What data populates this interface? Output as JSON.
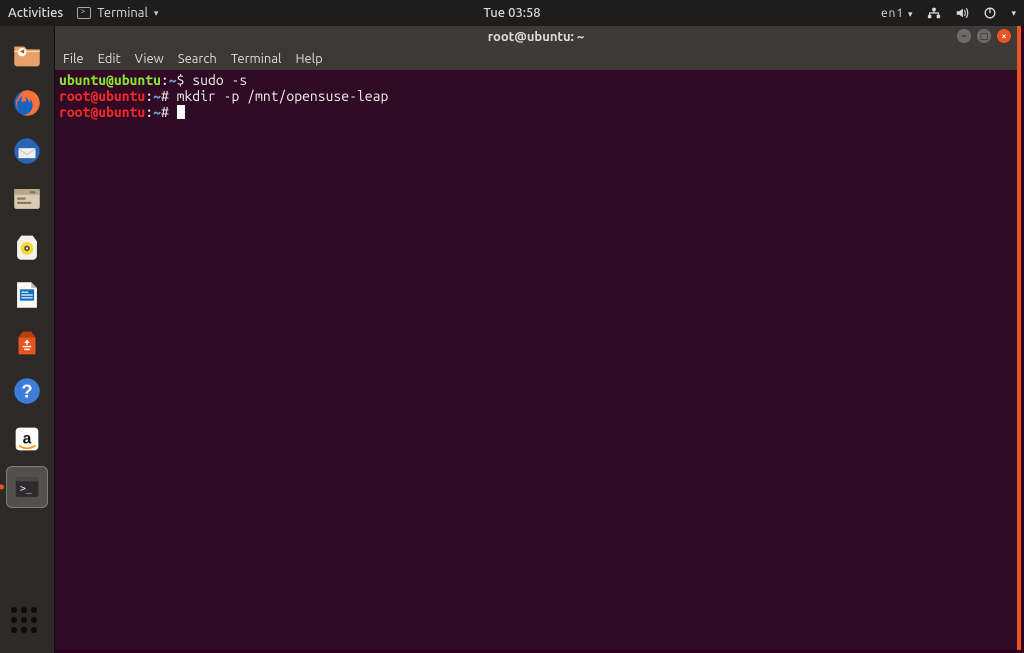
{
  "topbar": {
    "activities": "Activities",
    "app_label": "Terminal",
    "clock": "Tue 03:58",
    "input_source": "en1"
  },
  "window": {
    "title": "root@ubuntu: ~",
    "menus": [
      "File",
      "Edit",
      "View",
      "Search",
      "Terminal",
      "Help"
    ]
  },
  "dock": {
    "items": [
      {
        "name": "files"
      },
      {
        "name": "firefox"
      },
      {
        "name": "thunderbird"
      },
      {
        "name": "nautilus"
      },
      {
        "name": "rhythmbox"
      },
      {
        "name": "libreoffice-writer"
      },
      {
        "name": "software"
      },
      {
        "name": "help"
      },
      {
        "name": "amazon"
      },
      {
        "name": "terminal",
        "active": true
      }
    ]
  },
  "terminal": {
    "lines": [
      {
        "type": "user-prompt",
        "user": "ubuntu@ubuntu",
        "cwd": "~",
        "symbol": "$",
        "cmd": "sudo -s"
      },
      {
        "type": "root-prompt",
        "user": "root@ubuntu",
        "cwd": "~",
        "symbol": "#",
        "cmd": "mkdir -p /mnt/opensuse-leap"
      },
      {
        "type": "root-prompt",
        "user": "root@ubuntu",
        "cwd": "~",
        "symbol": "#",
        "cmd": ""
      }
    ]
  }
}
